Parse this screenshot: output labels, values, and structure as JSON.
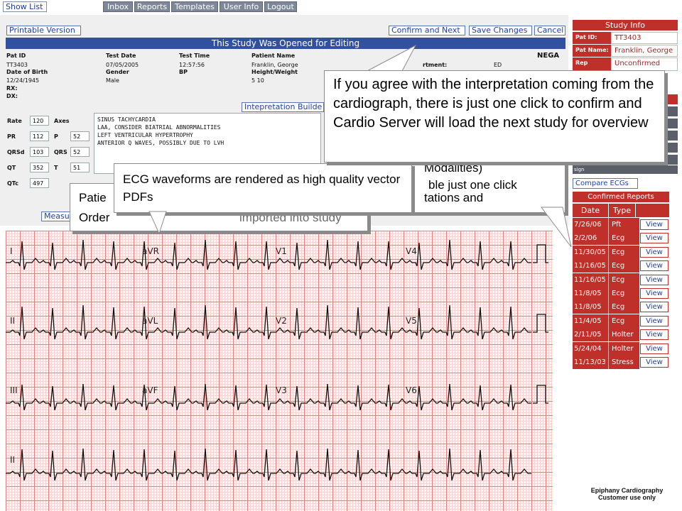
{
  "topbar": {
    "show_list": "Show List",
    "nav": [
      "Inbox",
      "Reports",
      "Templates",
      "User Info",
      "Logout"
    ]
  },
  "actions": {
    "printable": "Printable Version",
    "confirm_next": "Confirm and Next",
    "save_changes": "Save Changes",
    "cancel": "Cancel"
  },
  "banner": "This Study Was Opened for Editing",
  "study": {
    "lbl_patid": "Pat ID",
    "patid": "TT3403",
    "lbl_testdate": "Test Date",
    "testdate": "07/05/2005",
    "lbl_testtime": "Test Time",
    "testtime": "12:57:56",
    "lbl_patname": "Patient Name",
    "patname": "Franklin, George",
    "lbl_dob": "Date of Birth",
    "dob": "12/24/1945",
    "lbl_gender": "Gender",
    "gender": "Male",
    "lbl_bp": "BP",
    "lbl_hw": "Height/Weight",
    "hw": "5 10",
    "lbl_rx": "RX:",
    "lbl_dx": "DX:",
    "nega": "NEGA",
    "lbl_department_partial": "rtment:",
    "department": "ED"
  },
  "measurements": {
    "rate_lbl": "Rate",
    "rate": "120",
    "axes_lbl": "Axes",
    "pr_lbl": "PR",
    "pr": "112",
    "p_lbl": "P",
    "p": "52",
    "qrsd_lbl": "QRSd",
    "qrsd": "103",
    "qrs_lbl": "QRS",
    "qrs": "52",
    "qt_lbl": "QT",
    "qt": "352",
    "t_lbl": "T",
    "t": "51",
    "qtc_lbl": "QTc",
    "qtc": "497"
  },
  "interpretation_lines": [
    "SINUS TACHYCARDIA",
    "LAA, CONSIDER BIATRIAL ABNORMALITIES",
    "LEFT VENTRICULAR HYPERTROPHY",
    "ANTERIOR Q WAVES, POSSIBLY DUE TO LVH"
  ],
  "interp_builder_partial": "Intepretation Builde",
  "measu_partial": "Measu",
  "leads": [
    "I",
    "aVR",
    "V1",
    "V4",
    "II",
    "aVL",
    "V2",
    "V5",
    "III",
    "aVF",
    "V3",
    "V6",
    "II"
  ],
  "study_info": {
    "title": "Study Info",
    "patid_lbl": "Pat ID:",
    "patid": "TT3403",
    "patname_lbl": "Pat Name:",
    "patname": "Franklin, George",
    "rep_status_lbl": "Rep Status:",
    "rep_status": "Unconfirmed",
    "sign_partial": "sign"
  },
  "compare_ecgs": "Compare ECGs",
  "confirmed_reports": {
    "title": "Confirmed Reports",
    "col_date": "Date",
    "col_type": "Type",
    "view_label": "View",
    "rows": [
      {
        "date": "7/26/06",
        "type": "Pft"
      },
      {
        "date": "2/2/06",
        "type": "Ecg"
      },
      {
        "date": "11/30/05",
        "type": "Ecg"
      },
      {
        "date": "11/16/05",
        "type": "Ecg"
      },
      {
        "date": "11/16/05",
        "type": "Ecg"
      },
      {
        "date": "11/8/05",
        "type": "Ecg"
      },
      {
        "date": "11/8/05",
        "type": "Ecg"
      },
      {
        "date": "11/4/05",
        "type": "Ecg"
      },
      {
        "date": "2/11/05",
        "type": "Holter"
      },
      {
        "date": "5/24/04",
        "type": "Holter"
      },
      {
        "date": "11/13/03",
        "type": "Stress"
      }
    ]
  },
  "footer": {
    "line1": "Epiphany Cardiography",
    "line2": "Customer use only"
  },
  "callouts": {
    "confirm": "If you agree with the interpretation coming from the cardiograph, there is just one click to confirm and Cardio Server will load the next study for overview",
    "ecg_pdf": "ECG waveforms are rendered as high quality vector PDFs",
    "patient_partial_1": "Patie",
    "patient_partial_2": "Order",
    "patient_partial_3": "imported into study",
    "compare_partial_1": "Modalities)",
    "compare_partial_2": "ble just one click",
    "compare_partial_3": "tations and"
  }
}
